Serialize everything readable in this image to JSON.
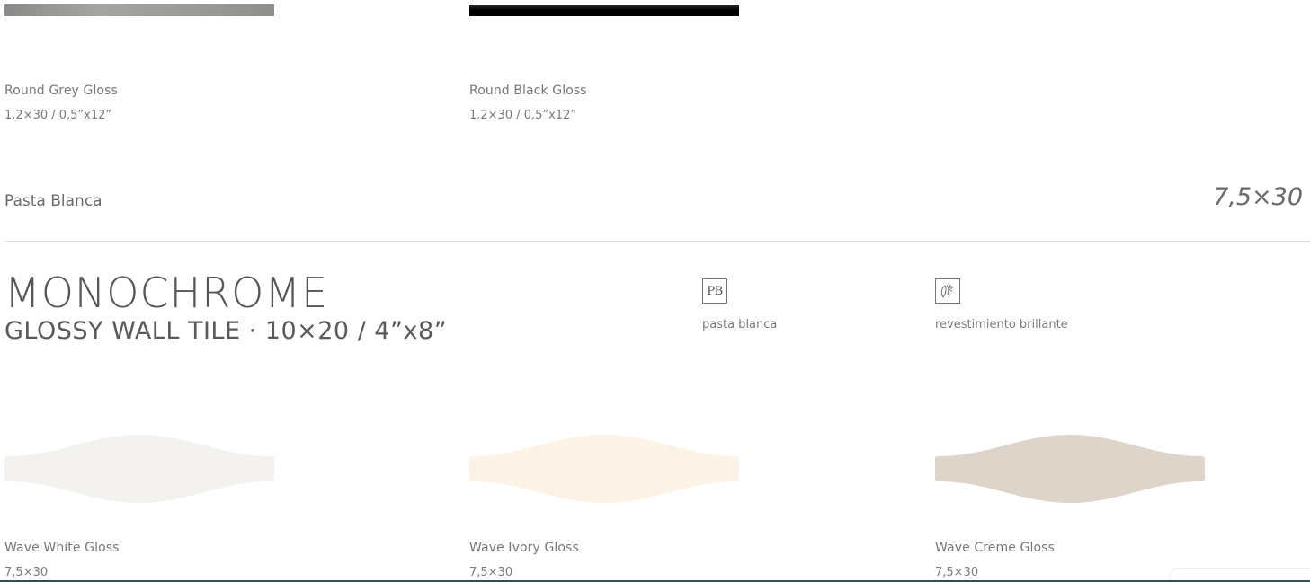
{
  "top_products": [
    {
      "name": "Round Grey Gloss",
      "size": "1,2×30 / 0,5”x12”",
      "color": "#9a9a98"
    },
    {
      "name": "Round Black Gloss",
      "size": "1,2×30 / 0,5”x12”",
      "color": "#000000"
    }
  ],
  "category": {
    "label": "Pasta Blanca",
    "size": "7,5×30"
  },
  "series": {
    "title": "MONOCHROME",
    "subtitle": "GLOSSY WALL TILE · 10×20 / 4”x8”"
  },
  "badges": [
    {
      "icon": "pb-icon",
      "glyph": "PB",
      "label": "pasta blanca"
    },
    {
      "icon": "glossy-icon",
      "label": "revestimiento brillante"
    }
  ],
  "wave_products": [
    {
      "name": "Wave White Gloss",
      "size": "7,5×30",
      "color": "#f3f2ef"
    },
    {
      "name": "Wave Ivory Gloss",
      "size": "7,5×30",
      "color": "#fcf3e6"
    },
    {
      "name": "Wave Creme Gloss",
      "size": "7,5×30",
      "color": "#ddd5c9"
    }
  ]
}
